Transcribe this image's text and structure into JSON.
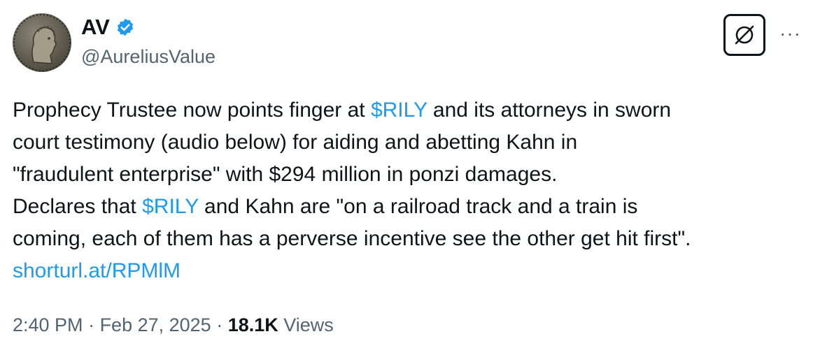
{
  "author": {
    "display_name": "AV",
    "handle": "@AureliusValue",
    "verified": true,
    "verified_color": "#1d9bf0",
    "avatar_icon": "roman-coin-avatar"
  },
  "tweet": {
    "line1_prefix": "Prophecy Trustee now points finger at ",
    "line1_cashtag": "$RILY",
    "line1_suffix": " and its attorneys in sworn",
    "line2": "court testimony (audio below) for aiding and abetting Kahn in",
    "line3": "\"fraudulent enterprise\" with $294 million in ponzi damages.",
    "line4_prefix": "Declares that ",
    "line4_cashtag": "$RILY",
    "line4_suffix": " and Kahn  are \"on a railroad track and a train is",
    "line5": "coming, each of them has a perverse incentive see the other get hit first\".",
    "link": "shorturl.at/RPMlM"
  },
  "meta": {
    "time": "2:40 PM",
    "separator1": " · ",
    "date": "Feb 27, 2025",
    "separator2": " · ",
    "views_count": "18.1K",
    "views_label": " Views"
  },
  "actions": {
    "grok_icon": "grok-icon",
    "more_icon": "more-horizontal-icon",
    "more_label": "···"
  },
  "colors": {
    "text": "#0f1419",
    "secondary": "#536471",
    "link": "#1d9bf0"
  }
}
